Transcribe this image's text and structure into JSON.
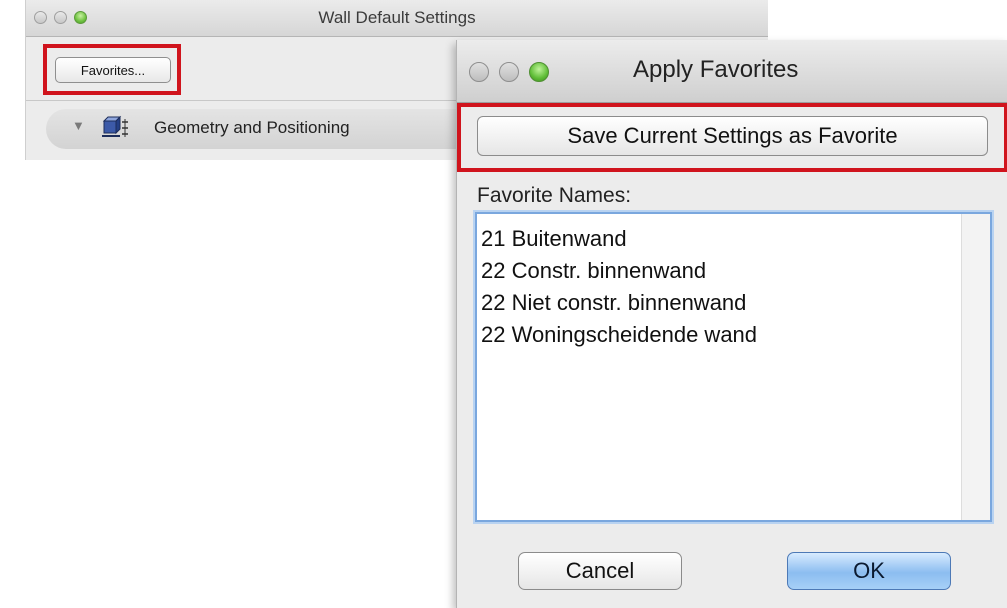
{
  "wall_window": {
    "title": "Wall Default Settings",
    "favorites_button": "Favorites...",
    "panel_label": "Geometry and Positioning"
  },
  "apply_window": {
    "title": "Apply Favorites",
    "save_button": "Save Current Settings as Favorite",
    "list_label": "Favorite Names:",
    "items": [
      "21 Buitenwand",
      "22 Constr. binnenwand",
      "22 Niet constr. binnenwand",
      "22 Woningscheidende wand"
    ],
    "cancel_button": "Cancel",
    "ok_button": "OK"
  },
  "colors": {
    "highlight": "#d0141d",
    "default_button": "#8cbdf0",
    "list_focus": "#7aa7de"
  },
  "icons": {
    "disclosure": "disclosure-triangle-icon",
    "geometry": "wall-geometry-icon"
  }
}
